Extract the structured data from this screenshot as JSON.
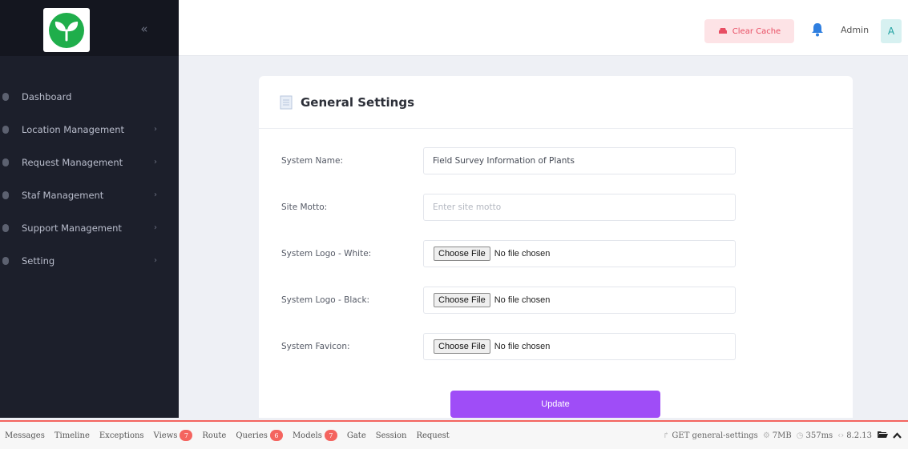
{
  "sidebar": {
    "logo_icon": "plant-sprout-logo",
    "collapse_icon": "double-chevron-left-icon",
    "items": [
      {
        "label": "Dashboard",
        "has_submenu": false
      },
      {
        "label": "Location Management",
        "has_submenu": true
      },
      {
        "label": "Request Management",
        "has_submenu": true
      },
      {
        "label": "Staf Management",
        "has_submenu": true
      },
      {
        "label": "Support Management",
        "has_submenu": true
      },
      {
        "label": "Setting",
        "has_submenu": true
      }
    ]
  },
  "header": {
    "clear_cache_label": "Clear Cache",
    "bell_icon": "bell-icon",
    "admin_name": "Admin",
    "avatar_letter": "A"
  },
  "card": {
    "title": "General Settings",
    "title_icon": "document-icon",
    "fields": {
      "system_name": {
        "label": "System Name:",
        "value": "Field Survey Information of Plants"
      },
      "site_motto": {
        "label": "Site Motto:",
        "value": "",
        "placeholder": "Enter site motto"
      },
      "logo_white": {
        "label": "System Logo - White:"
      },
      "logo_black": {
        "label": "System Logo - Black:"
      },
      "favicon": {
        "label": "System Favicon:"
      }
    },
    "file_button_label": "Choose File",
    "no_file_text": "No file chosen",
    "update_label": "Update"
  },
  "debugbar": {
    "tabs": [
      {
        "label": "Messages",
        "badge": null
      },
      {
        "label": "Timeline",
        "badge": null
      },
      {
        "label": "Exceptions",
        "badge": null
      },
      {
        "label": "Views",
        "badge": "7"
      },
      {
        "label": "Route",
        "badge": null
      },
      {
        "label": "Queries",
        "badge": "6"
      },
      {
        "label": "Models",
        "badge": "7"
      },
      {
        "label": "Gate",
        "badge": null
      },
      {
        "label": "Session",
        "badge": null
      },
      {
        "label": "Request",
        "badge": null
      }
    ],
    "route": "GET general-settings",
    "memory": "7MB",
    "time": "357ms",
    "php_version": "8.2.13"
  },
  "colors": {
    "sidebar_bg": "#1c1f2b",
    "accent_purple": "#9f4df7",
    "clear_cache_bg": "#fde3e6",
    "clear_cache_text": "#e84e63",
    "bell": "#2f7fe0",
    "avatar_bg": "#d7f1f1",
    "debug_badge": "#f4645f",
    "logo_green": "#1fae4b"
  }
}
